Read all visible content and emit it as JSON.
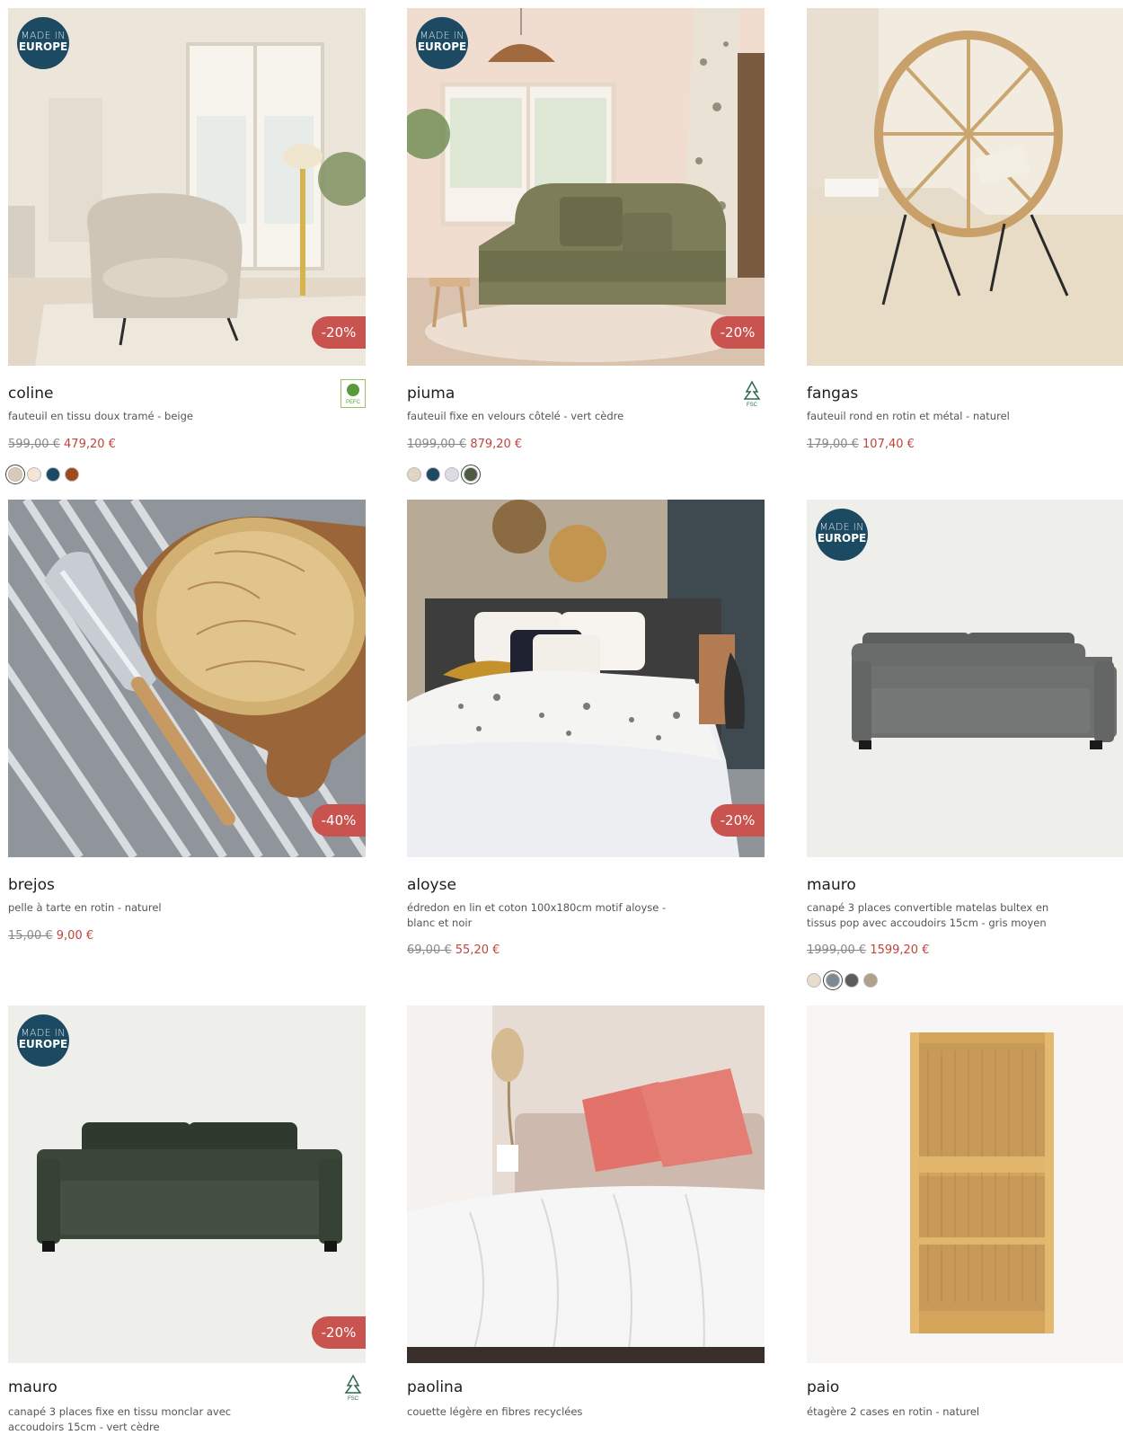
{
  "badges": {
    "made_in_l1": "MADE IN",
    "made_in_l2": "EUROPE"
  },
  "products": [
    {
      "name": "coline",
      "desc": "fauteuil en tissu doux tramé - beige",
      "old": "599,00 €",
      "new": "479,20 €",
      "discount": "-20%",
      "swatches": [
        "#d8cbb6",
        "#f3e6d6",
        "#1d4a63",
        "#a14a1d"
      ],
      "selected": 0,
      "cert": "pefc-icon"
    },
    {
      "name": "piuma",
      "desc": "fauteuil fixe en velours côtelé - vert cèdre",
      "old": "1099,00 €",
      "new": "879,20 €",
      "discount": "-20%",
      "swatches": [
        "#e2d4c1",
        "#1d4a63",
        "#d9dde2",
        "#4e5a44"
      ],
      "selected": 3,
      "cert": "fsc-icon"
    },
    {
      "name": "fangas",
      "desc": "fauteuil rond en rotin et métal - naturel",
      "old": "179,00 €",
      "new": "107,40 €",
      "discount": ""
    },
    {
      "name": "brejos",
      "desc": "pelle à tarte en rotin - naturel",
      "old": "15,00 €",
      "new": "9,00 €",
      "discount": "-40%"
    },
    {
      "name": "aloyse",
      "desc": "édredon en lin et coton 100x180cm motif aloyse - blanc et noir",
      "old": "69,00 €",
      "new": "55,20 €",
      "discount": "-20%"
    },
    {
      "name": "mauro",
      "desc": "canapé 3 places convertible matelas bultex en tissus pop avec accoudoirs 15cm - gris moyen",
      "old": "1999,00 €",
      "new": "1599,20 €",
      "discount": "",
      "swatches": [
        "#e8dccb",
        "#7d8a92",
        "#5c5c5c",
        "#b1a08a"
      ],
      "selected": 1
    },
    {
      "name": "mauro",
      "desc": "canapé 3 places fixe en tissu monclar avec accoudoirs 15cm - vert cèdre",
      "discount": "-20%",
      "cert": "fsc-icon"
    },
    {
      "name": "paolina",
      "desc": "couette légère en fibres recyclées"
    },
    {
      "name": "paio",
      "desc": "étagère 2 cases en rotin - naturel"
    }
  ],
  "cert_labels": {
    "pefc": "PEFC",
    "fsc": "FSC"
  }
}
